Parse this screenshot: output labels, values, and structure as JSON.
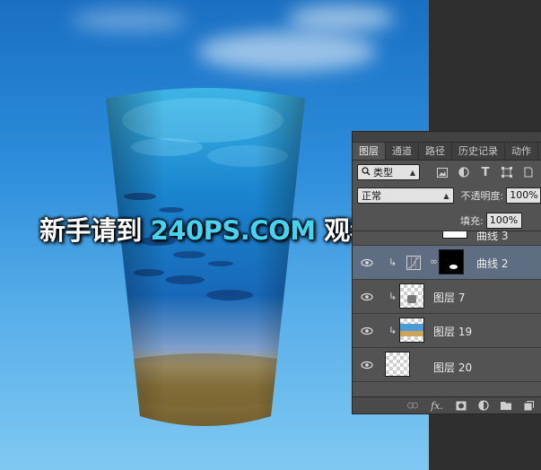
{
  "watermark": {
    "prefix": "新手请到 ",
    "site": "240PS.COM",
    "suffix": " 观看视频教程"
  },
  "layers_panel": {
    "tabs": [
      {
        "label": "图层",
        "active": true
      },
      {
        "label": "通道",
        "active": false
      },
      {
        "label": "路径",
        "active": false
      },
      {
        "label": "历史记录",
        "active": false
      },
      {
        "label": "动作",
        "active": false
      }
    ],
    "filter": {
      "label": "类型"
    },
    "blend_mode": "正常",
    "opacity": {
      "label": "不透明度:",
      "value": "100%"
    },
    "fill": {
      "label": "填充:",
      "value": "100%"
    },
    "layers": [
      {
        "name": "曲线 3",
        "type": "curves",
        "clipped": true,
        "visible": true,
        "selected": false
      },
      {
        "name": "曲线 2",
        "type": "curves",
        "clipped": true,
        "visible": true,
        "selected": true
      },
      {
        "name": "图层 7",
        "type": "pixel",
        "clipped": true,
        "visible": true,
        "selected": false
      },
      {
        "name": "图层 19",
        "type": "pixel",
        "clipped": true,
        "visible": true,
        "selected": false
      },
      {
        "name": "图层 20",
        "type": "pixel",
        "clipped": false,
        "visible": true,
        "selected": false
      }
    ],
    "bottom_tools": [
      "link-icon",
      "fx-icon",
      "mask-icon",
      "adjustment-icon",
      "folder-icon",
      "new-layer-icon"
    ],
    "bottom_fx_label": "fx."
  },
  "colors": {
    "panel_bg": "#535353",
    "selected_layer": "#5f6d82",
    "watermark_accent": "#45d3f2",
    "dark_side": "#2f2f2f"
  }
}
